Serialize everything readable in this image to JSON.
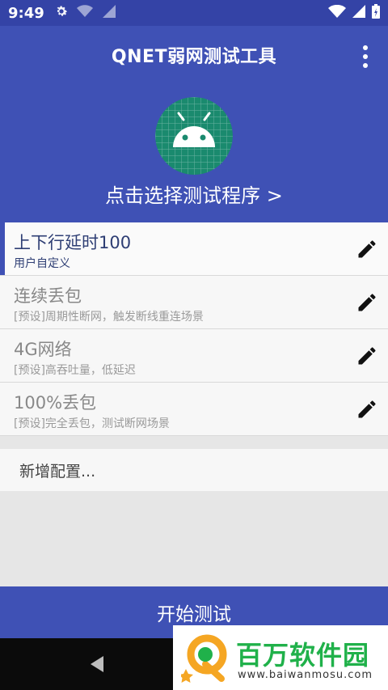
{
  "status_bar": {
    "time": "9:49",
    "icons": [
      "gear-icon",
      "wifi-icon",
      "signal-icon",
      "battery-icon"
    ]
  },
  "app_bar": {
    "title": "QNET弱网测试工具",
    "menu_icon": "more-vert-icon"
  },
  "header": {
    "app_icon": "android-icon",
    "select_program": "点击选择测试程序 >"
  },
  "profiles": [
    {
      "title": "上下行延时100",
      "subtitle": "用户自定义",
      "selected": true
    },
    {
      "title": "连续丢包",
      "subtitle": "[预设]周期性断网，触发断线重连场景",
      "selected": false
    },
    {
      "title": "4G网络",
      "subtitle": "[预设]高吞吐量，低延迟",
      "selected": false
    },
    {
      "title": "100%丢包",
      "subtitle": "[预设]完全丢包，测试断网场景",
      "selected": false
    }
  ],
  "add_config": "新增配置...",
  "start_button": "开始测试",
  "watermark": {
    "name": "百万软件园",
    "url": "www.baiwanmosu.com"
  },
  "colors": {
    "primary": "#3f51b5",
    "status_bar": "#3443a6",
    "icon_bg": "#1a8a6e",
    "watermark_green": "#20b14a"
  }
}
